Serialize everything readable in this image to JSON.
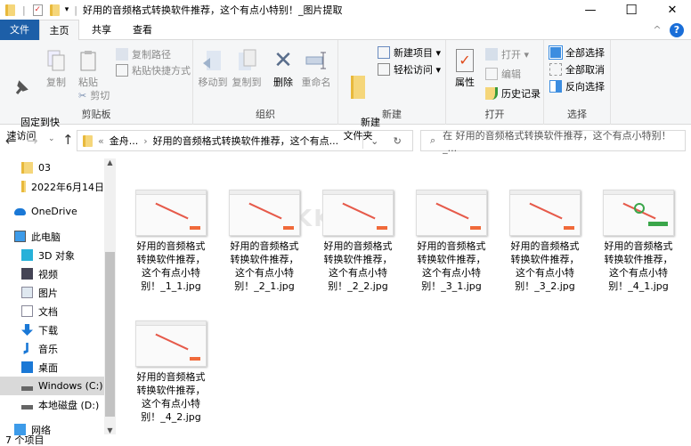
{
  "window": {
    "title": "好用的音频格式转换软件推荐，这个有点小特别！_图片提取",
    "qat_dropdown": "▾",
    "minimize": "—",
    "maximize": "☐",
    "close": "✕"
  },
  "tabs": [
    {
      "label": "文件"
    },
    {
      "label": "主页"
    },
    {
      "label": "共享"
    },
    {
      "label": "查看"
    }
  ],
  "ribbon": {
    "clipboard": {
      "label": "剪贴板",
      "pin": "固定到快\n速访问",
      "copy": "复制",
      "paste": "粘贴",
      "copy_path": "复制路径",
      "paste_shortcut": "粘贴快捷方式",
      "cut": "剪切"
    },
    "organize": {
      "label": "组织",
      "move_to": "移动到",
      "copy_to": "复制到",
      "delete": "删除",
      "rename": "重命名"
    },
    "new": {
      "label": "新建",
      "new_folder": "新建\n文件夹",
      "new_item": "新建项目 ▾",
      "easy_access": "轻松访问 ▾"
    },
    "open": {
      "label": "打开",
      "properties": "属性",
      "open": "打开 ▾",
      "edit": "编辑",
      "history": "历史记录"
    },
    "select": {
      "label": "选择",
      "select_all": "全部选择",
      "select_none": "全部取消",
      "invert": "反向选择"
    },
    "collapse": "^",
    "help": "?"
  },
  "address": {
    "prefix": "«",
    "crumbs": [
      "金舟...",
      "好用的音频格式转换软件推荐，这个有点..."
    ],
    "sep": "›",
    "dropdown": "⌄",
    "refresh": "↻"
  },
  "search": {
    "placeholder": "在 好用的音频格式转换软件推荐，这个有点小特别！_..."
  },
  "nav": [
    {
      "label": "03",
      "icon": "folder-icon"
    },
    {
      "label": "2022年6月14日",
      "icon": "folder-icon"
    },
    {
      "label": "OneDrive",
      "icon": "cloud-icon"
    },
    {
      "label": "此电脑",
      "icon": "computer-icon"
    },
    {
      "label": "3D 对象",
      "icon": "cube-icon"
    },
    {
      "label": "视频",
      "icon": "video-icon"
    },
    {
      "label": "图片",
      "icon": "picture-icon"
    },
    {
      "label": "文档",
      "icon": "document-icon"
    },
    {
      "label": "下载",
      "icon": "download-icon"
    },
    {
      "label": "音乐",
      "icon": "music-icon"
    },
    {
      "label": "桌面",
      "icon": "desktop-icon"
    },
    {
      "label": "Windows (C:)",
      "icon": "drive-icon"
    },
    {
      "label": "本地磁盘 (D:)",
      "icon": "drive-icon"
    },
    {
      "label": "网络",
      "icon": "network-icon"
    }
  ],
  "files": [
    {
      "name": "好用的音频格式转换软件推荐，这个有点小特别！_1_1.jpg"
    },
    {
      "name": "好用的音频格式转换软件推荐，这个有点小特别！_2_1.jpg"
    },
    {
      "name": "好用的音频格式转换软件推荐，这个有点小特别！_2_2.jpg"
    },
    {
      "name": "好用的音频格式转换软件推荐，这个有点小特别！_3_1.jpg"
    },
    {
      "name": "好用的音频格式转换软件推荐，这个有点小特别！_3_2.jpg"
    },
    {
      "name": "好用的音频格式转换软件推荐，这个有点小特别！_4_1.jpg"
    },
    {
      "name": "好用的音频格式转换软件推荐，这个有点小特别！_4_2.jpg"
    }
  ],
  "watermark": "KK下载",
  "status": {
    "count": "7 个项目"
  },
  "colors": {
    "accent": "#1a5fb4",
    "file_tab": "#1d5fa8",
    "folder": "#f5d67a"
  }
}
